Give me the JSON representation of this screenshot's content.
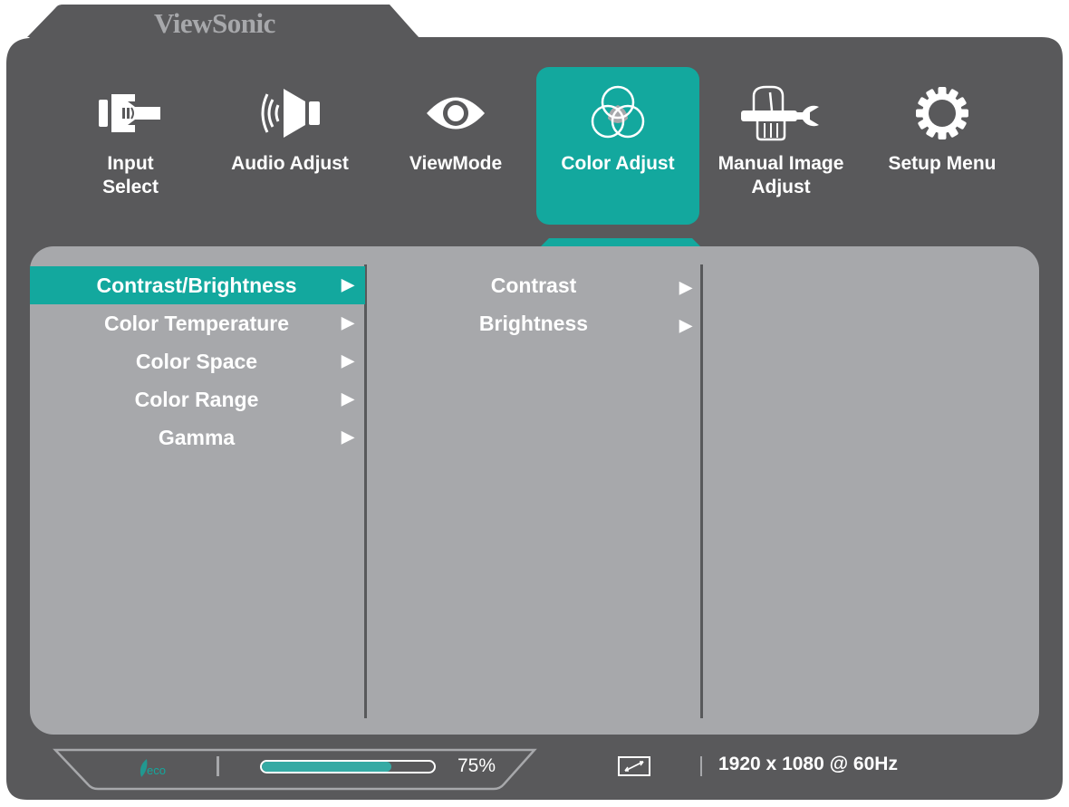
{
  "brand": "ViewSonic",
  "colors": {
    "bezel": "#59595b",
    "panel": "#a7a8ab",
    "accent": "#13a89e",
    "progress_fill": "#35aaa4",
    "text": "#ffffff"
  },
  "tabs": [
    {
      "id": "input-select",
      "label": "Input\nSelect",
      "icon": "input-connector-icon",
      "active": false
    },
    {
      "id": "audio-adjust",
      "label": "Audio Adjust",
      "icon": "speaker-icon",
      "active": false
    },
    {
      "id": "viewmode",
      "label": "ViewMode",
      "icon": "eye-icon",
      "active": false
    },
    {
      "id": "color-adjust",
      "label": "Color Adjust",
      "icon": "color-circles-icon",
      "active": true
    },
    {
      "id": "manual-image-adjust",
      "label": "Manual Image\nAdjust",
      "icon": "hand-wrench-icon",
      "active": false
    },
    {
      "id": "setup-menu",
      "label": "Setup Menu",
      "icon": "gear-icon",
      "active": false
    }
  ],
  "menu": {
    "items": [
      {
        "label": "Contrast/Brightness",
        "arrow": "▶",
        "selected": true
      },
      {
        "label": "Color Temperature",
        "arrow": "▶",
        "selected": false
      },
      {
        "label": "Color Space",
        "arrow": "▶",
        "selected": false
      },
      {
        "label": "Color Range",
        "arrow": "▶",
        "selected": false
      },
      {
        "label": "Gamma",
        "arrow": "▶",
        "selected": false
      }
    ],
    "submenu": [
      {
        "label": "Contrast",
        "arrow": "▶"
      },
      {
        "label": "Brightness",
        "arrow": "▶"
      }
    ]
  },
  "status": {
    "eco_label": "eco",
    "progress_percent": 75,
    "progress_text": "75%",
    "aspect_icon": "aspect-ratio-icon",
    "resolution": "1920 x 1080 @ 60Hz"
  }
}
